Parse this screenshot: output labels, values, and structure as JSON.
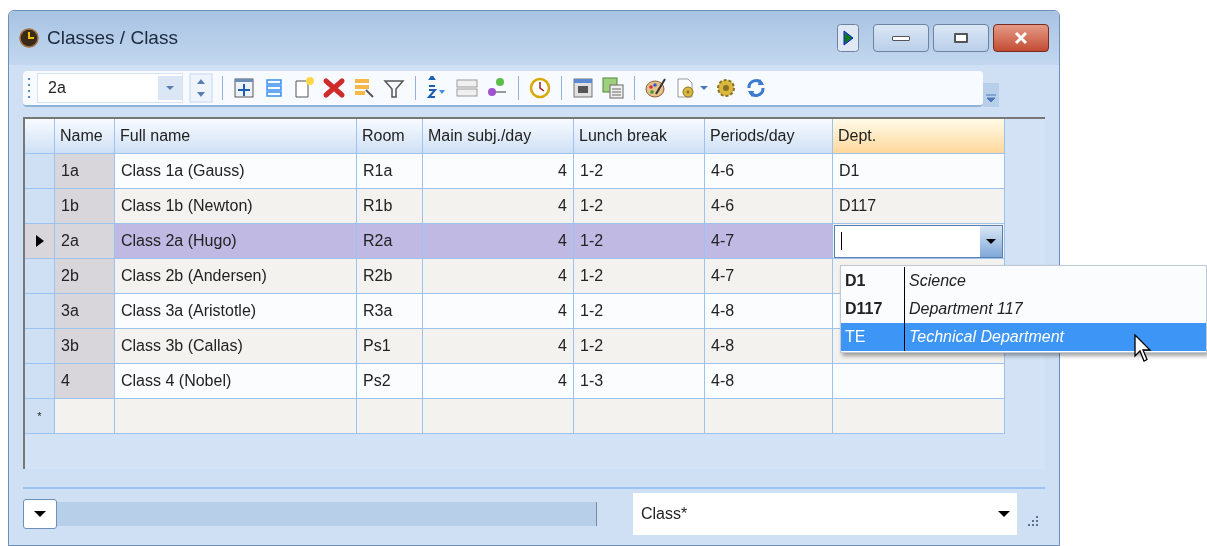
{
  "window": {
    "title": "Classes / Class"
  },
  "toolbar": {
    "combo_value": "2a"
  },
  "table": {
    "columns": [
      "Name",
      "Full name",
      "Room",
      "Main subj./day",
      "Lunch break",
      "Periods/day",
      "Dept."
    ],
    "rows": [
      {
        "selected": false,
        "cells": [
          "1a",
          "Class 1a (Gauss)",
          "R1a",
          "4",
          "1-2",
          "4-6",
          "D1"
        ]
      },
      {
        "selected": false,
        "cells": [
          "1b",
          "Class 1b (Newton)",
          "R1b",
          "4",
          "1-2",
          "4-6",
          "D117"
        ]
      },
      {
        "selected": true,
        "cells": [
          "2a",
          "Class 2a (Hugo)",
          "R2a",
          "4",
          "1-2",
          "4-7",
          ""
        ]
      },
      {
        "selected": false,
        "cells": [
          "2b",
          "Class 2b (Andersen)",
          "R2b",
          "4",
          "1-2",
          "4-7",
          ""
        ]
      },
      {
        "selected": false,
        "cells": [
          "3a",
          "Class 3a (Aristotle)",
          "R3a",
          "4",
          "1-2",
          "4-8",
          ""
        ]
      },
      {
        "selected": false,
        "cells": [
          "3b",
          "Class 3b (Callas)",
          "Ps1",
          "4",
          "1-2",
          "4-8",
          ""
        ]
      },
      {
        "selected": false,
        "cells": [
          "4",
          "Class 4 (Nobel)",
          "Ps2",
          "4",
          "1-3",
          "4-8",
          ""
        ]
      }
    ],
    "new_row_marker": "*"
  },
  "dept_dropdown": {
    "options": [
      {
        "code": "D1",
        "name": "Science",
        "selected": false
      },
      {
        "code": "D117",
        "name": "Department 117",
        "selected": false
      },
      {
        "code": "TE",
        "name": "Technical Department",
        "selected": true
      }
    ]
  },
  "status_bar": {
    "view_combo": "Class*"
  }
}
